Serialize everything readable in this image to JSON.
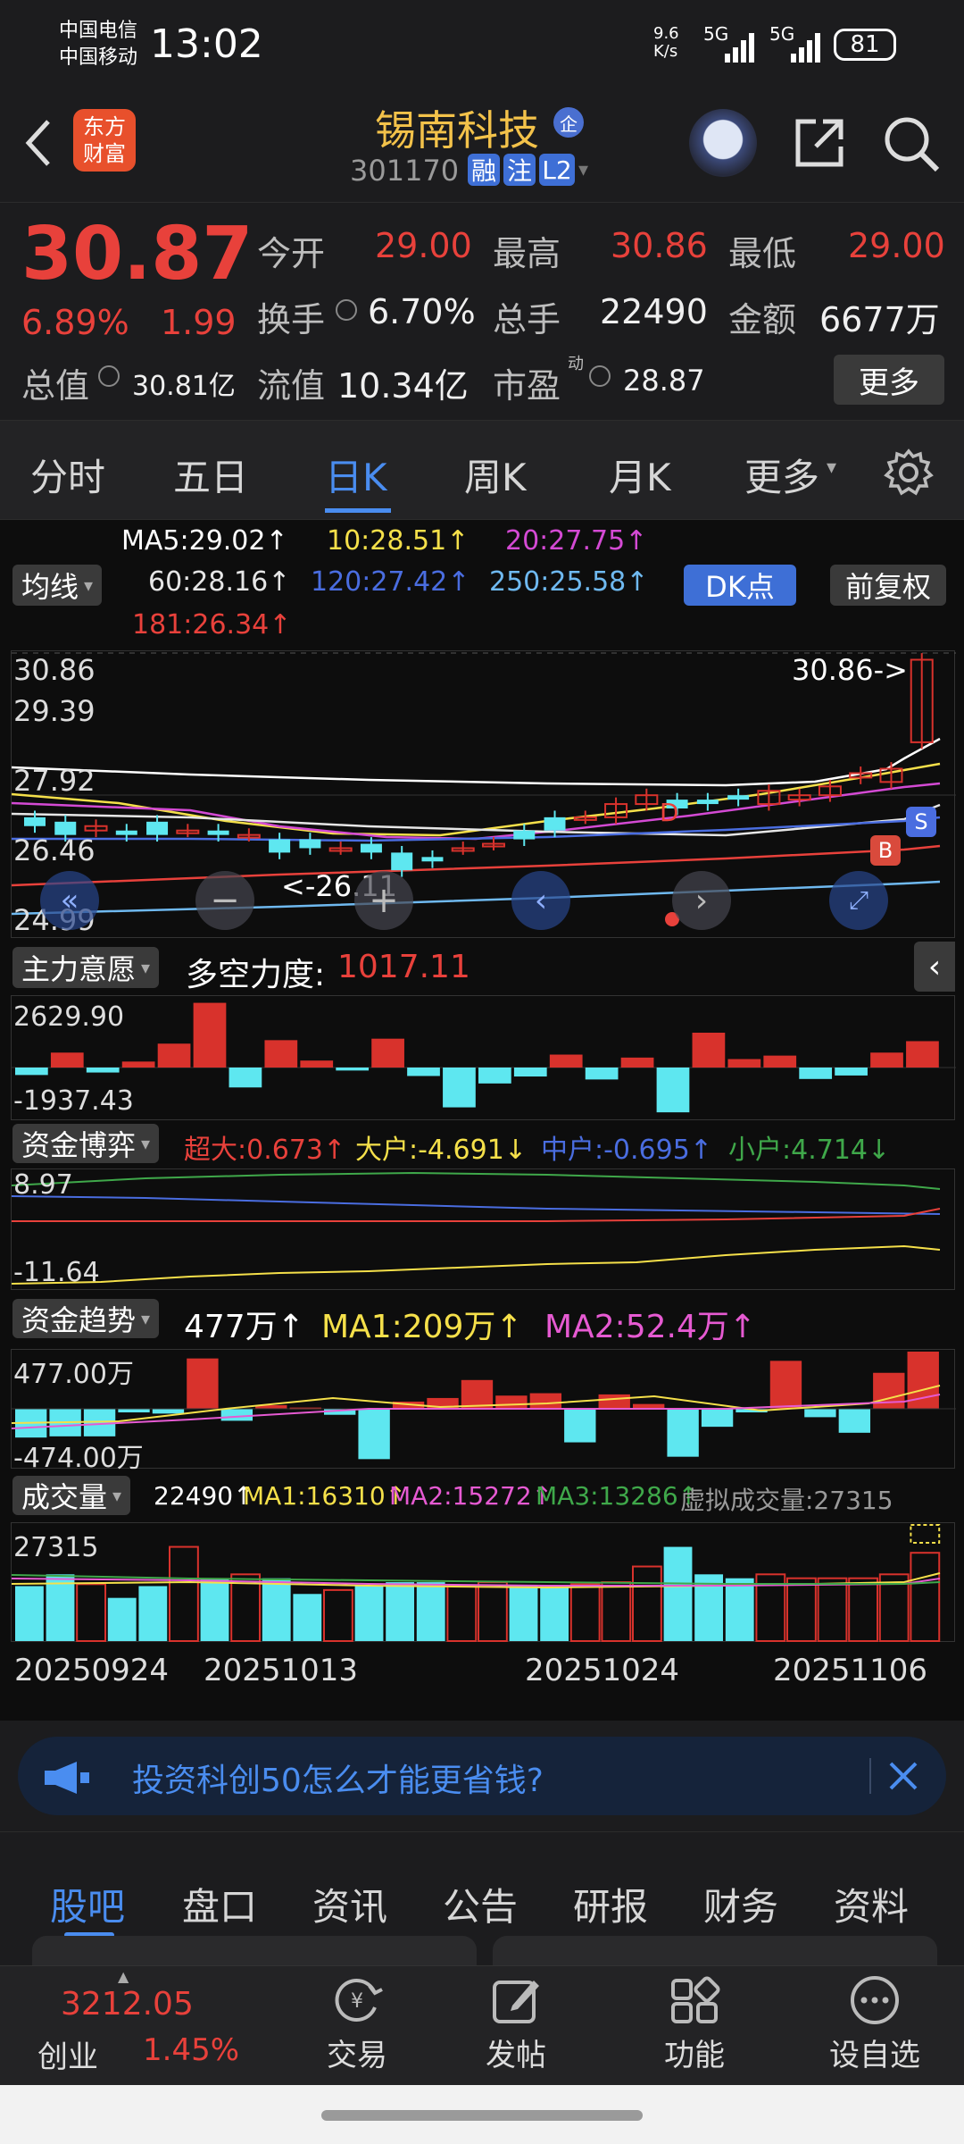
{
  "status": {
    "carrier1": "中国电信",
    "carrier2": "中国移动",
    "time": "13:02",
    "net_speed": "9.6\nK/s",
    "sig1": "5G",
    "sig2": "5G",
    "battery": "81"
  },
  "header": {
    "logo_line1": "东方",
    "logo_line2": "财富",
    "name": "锡南科技",
    "name_tag": "企",
    "code": "301170",
    "tags": [
      "融",
      "注",
      "L2"
    ]
  },
  "quote": {
    "price": "30.87",
    "change_pct": "6.89%",
    "change": "1.99",
    "open_label": "今开",
    "open": "29.00",
    "high_label": "最高",
    "high": "30.86",
    "low_label": "最低",
    "low": "29.00",
    "turnover_label": "换手",
    "turnover": "6.70%",
    "volume_label": "总手",
    "volume": "22490",
    "amount_label": "金额",
    "amount": "6677万",
    "mktcap_label": "总值",
    "mktcap": "30.81亿",
    "float_label": "流值",
    "float": "10.34亿",
    "pe_label": "市盈",
    "pe_sup": "动",
    "pe": "28.87",
    "more": "更多"
  },
  "period_tabs": [
    "分时",
    "五日",
    "日K",
    "周K",
    "月K",
    "更多"
  ],
  "active_tab": "日K",
  "ma": {
    "selector": "均线",
    "ma5": "MA5:29.02↑",
    "ma10": "10:28.51↑",
    "ma20": "20:27.75↑",
    "ma60": "60:28.16↑",
    "ma120": "120:27.42↑",
    "ma250": "250:25.58↑",
    "ma181": "181:26.34↑",
    "dk": "DK点",
    "fuquan": "前复权"
  },
  "main_chart": {
    "y_labels": [
      "30.86",
      "29.39",
      "27.92",
      "26.46",
      "24.99"
    ],
    "high_note": "30.86->",
    "low_note": "<-26.11",
    "sig_s": "S",
    "sig_b": "B",
    "sig_d": "D"
  },
  "ind1": {
    "name": "主力意愿",
    "label": "多空力度:",
    "value": "1017.11",
    "top": "2629.90",
    "bottom": "-1937.43"
  },
  "ind2": {
    "name": "资金博弈",
    "cd": "超大:0.673↑",
    "dh": "大户:-4.691↓",
    "zh": "中户:-0.695↑",
    "xh": "小户:4.714↓",
    "top": "8.97",
    "bottom": "-11.64"
  },
  "ind3": {
    "name": "资金趋势",
    "v": "477万↑",
    "ma1": "MA1:209万↑",
    "ma2": "MA2:52.4万↑",
    "top": "477.00万",
    "bottom": "-474.00万"
  },
  "ind4": {
    "name": "成交量",
    "v": "22490↑",
    "ma1": "MA1:16310↑",
    "ma2": "MA2:15272↑",
    "ma3": "MA3:13286↑",
    "virtual": "虚拟成交量:27315",
    "top": "27315"
  },
  "dates": [
    "20250924",
    "20251013",
    "20251024",
    "20251106"
  ],
  "ad": {
    "text": "投资科创50怎么才能更省钱?"
  },
  "bottom_tabs": [
    "股吧",
    "盘口",
    "资讯",
    "公告",
    "研报",
    "财务",
    "资料"
  ],
  "nav": {
    "index_value": "3212.05",
    "index_name": "创业",
    "index_pct": "1.45%",
    "items": [
      "交易",
      "发帖",
      "功能",
      "设自选"
    ]
  },
  "chart_data": {
    "type": "candlestick",
    "candles": [
      {
        "o": 27.3,
        "c": 27.1
      },
      {
        "o": 27.2,
        "c": 26.9
      },
      {
        "o": 27.0,
        "c": 27.1
      },
      {
        "o": 27.0,
        "c": 26.9
      },
      {
        "o": 27.2,
        "c": 26.9
      },
      {
        "o": 27.0,
        "c": 27.0
      },
      {
        "o": 27.0,
        "c": 26.9
      },
      {
        "o": 26.9,
        "c": 26.9
      },
      {
        "o": 26.8,
        "c": 26.5
      },
      {
        "o": 26.8,
        "c": 26.6
      },
      {
        "o": 26.6,
        "c": 26.6
      },
      {
        "o": 26.7,
        "c": 26.5
      },
      {
        "o": 26.5,
        "c": 26.1
      },
      {
        "o": 26.4,
        "c": 26.3
      },
      {
        "o": 26.6,
        "c": 26.6
      },
      {
        "o": 26.7,
        "c": 26.7
      },
      {
        "o": 27.0,
        "c": 26.8
      },
      {
        "o": 27.3,
        "c": 27.0
      },
      {
        "o": 27.3,
        "c": 27.3
      },
      {
        "o": 27.3,
        "c": 27.6
      },
      {
        "o": 27.6,
        "c": 27.8
      },
      {
        "o": 27.7,
        "c": 27.5
      },
      {
        "o": 27.7,
        "c": 27.6
      },
      {
        "o": 27.8,
        "c": 27.7
      },
      {
        "o": 27.6,
        "c": 27.9
      },
      {
        "o": 27.7,
        "c": 27.8
      },
      {
        "o": 27.8,
        "c": 28.0
      },
      {
        "o": 28.2,
        "c": 28.3
      },
      {
        "o": 28.1,
        "c": 28.4
      },
      {
        "o": 29.0,
        "c": 30.87
      }
    ],
    "ind1": [
      -150,
      300,
      -100,
      120,
      480,
      1300,
      -400,
      550,
      140,
      -60,
      580,
      -170,
      -800,
      -320,
      -180,
      260,
      -240,
      200,
      -900,
      700,
      170,
      240,
      -230,
      -160,
      300,
      530
    ],
    "ind3": [
      -240,
      -230,
      -230,
      -30,
      -40,
      420,
      -100,
      30,
      10,
      -50,
      -420,
      60,
      90,
      240,
      110,
      130,
      -280,
      120,
      40,
      -400,
      -150,
      -30,
      400,
      -70,
      -200,
      300,
      477
    ],
    "vol": [
      14000,
      17000,
      14500,
      11000,
      14000,
      24000,
      16000,
      17000,
      16000,
      12000,
      13000,
      14000,
      15000,
      15000,
      14000,
      15000,
      14000,
      14000,
      14500,
      15000,
      19000,
      24000,
      17000,
      16000,
      17000,
      16000,
      16000,
      16000,
      17000,
      22490
    ]
  }
}
